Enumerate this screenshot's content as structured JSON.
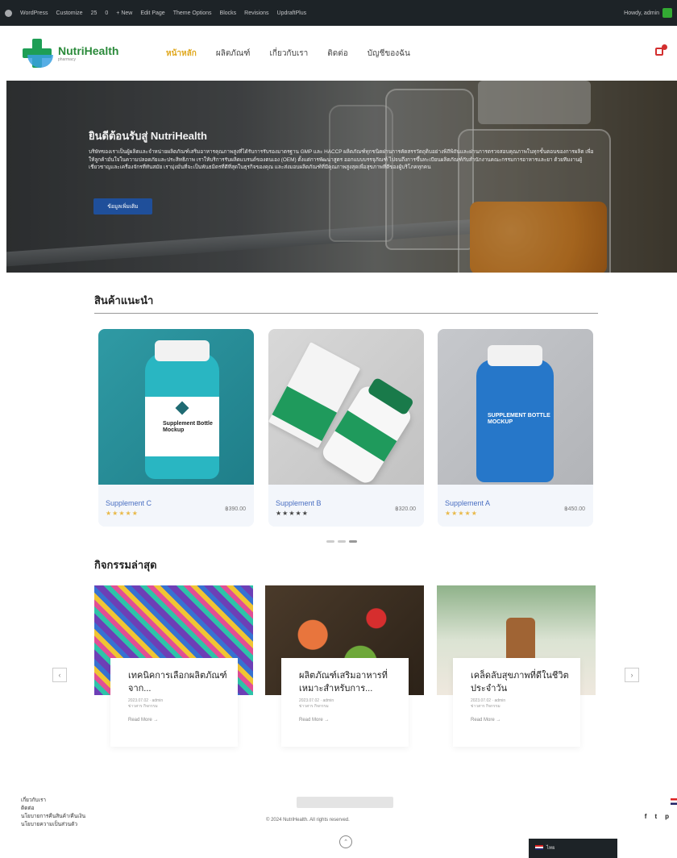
{
  "adminbar": {
    "items": [
      "WordPress",
      "Customize",
      "25",
      "0",
      "+ New",
      "Edit Page",
      "Theme Options",
      "Blocks",
      "Revisions",
      "UpdraftPlus"
    ],
    "right": "Howdy, admin"
  },
  "header": {
    "logo_text": "NutriHealth",
    "logo_tagline": "pharmacy",
    "nav": [
      {
        "label": "หน้าหลัก",
        "active": true
      },
      {
        "label": "ผลิตภัณฑ์",
        "active": false
      },
      {
        "label": "เกี่ยวกับเรา",
        "active": false
      },
      {
        "label": "ติดต่อ",
        "active": false
      },
      {
        "label": "บัญชีของฉัน",
        "active": false
      }
    ]
  },
  "hero": {
    "title": "ยินดีต้อนรับสู่ NutriHealth",
    "text": "บริษัทของเราเป็นผู้ผลิตและจำหน่ายผลิตภัณฑ์เสริมอาหารคุณภาพสูงที่ได้รับการรับรองมาตรฐาน GMP และ HACCP ผลิตภัณฑ์ทุกชนิดผ่านการคัดสรรวัตถุดิบอย่างพิถีพิถันและผ่านการตรวจสอบคุณภาพในทุกขั้นตอนของการผลิต เพื่อให้ลูกค้ามั่นใจในความปลอดภัยและประสิทธิภาพ เราให้บริการรับผลิตแบรนด์ของตนเอง (OEM) ตั้งแต่การพัฒนาสูตร ออกแบบบรรจุภัณฑ์ ไปจนถึงการขึ้นทะเบียนผลิตภัณฑ์กับสำนักงานคณะกรรมการอาหารและยา ด้วยทีมงานผู้เชี่ยวชาญและเครื่องจักรที่ทันสมัย เรามุ่งมั่นที่จะเป็นพันธมิตรที่ดีที่สุดในธุรกิจของคุณ และส่งมอบผลิตภัณฑ์ที่มีคุณภาพสูงสุดเพื่อสุขภาพที่ดีของผู้บริโภคทุกคน",
    "button": "ข้อมูลเพิ่มเติม"
  },
  "products": {
    "title": "สินค้าแนะนำ",
    "items": [
      {
        "name": "Supplement C",
        "price": "฿390.00",
        "stars": "★★★★★",
        "star_color": "#e9b949",
        "label": "Supplement Bottle Mockup"
      },
      {
        "name": "Supplement B",
        "price": "฿320.00",
        "stars": "★★★★★",
        "star_color": "#444444",
        "label": "Supplement"
      },
      {
        "name": "Supplement A",
        "price": "฿450.00",
        "stars": "★★★★★",
        "star_color": "#e9b949",
        "label": "SUPPLEMENT BOTTLE MOCKUP"
      }
    ]
  },
  "activities": {
    "title": "กิจกรรมล่าสุด",
    "items": [
      {
        "title": "เทคนิคการเลือกผลิตภัณฑ์จาก...",
        "date": "2023.07.02",
        "author": "admin",
        "category": "ข่าวสาร กิจกรรม",
        "more": "Read More →"
      },
      {
        "title": "ผลิตภัณฑ์เสริมอาหารที่เหมาะสำหรับการ...",
        "date": "2023.07.02",
        "author": "admin",
        "category": "ข่าวสาร กิจกรรม",
        "more": "Read More →"
      },
      {
        "title": "เคล็ดลับสุขภาพที่ดีในชีวิตประจำวัน",
        "date": "2023.07.02",
        "author": "admin",
        "category": "ข่าวสาร กิจกรรม",
        "more": "Read More →"
      }
    ]
  },
  "footer": {
    "links": [
      "เกี่ยวกับเรา",
      "ติดต่อ",
      "นโยบายการคืนสินค้า/คืนเงิน",
      "นโยบายความเป็นส่วนตัว"
    ],
    "copyright": "© 2024 NutriHealth. All rights reserved.",
    "socials": [
      "f",
      "t",
      "p"
    ],
    "lang": "ไทย"
  }
}
